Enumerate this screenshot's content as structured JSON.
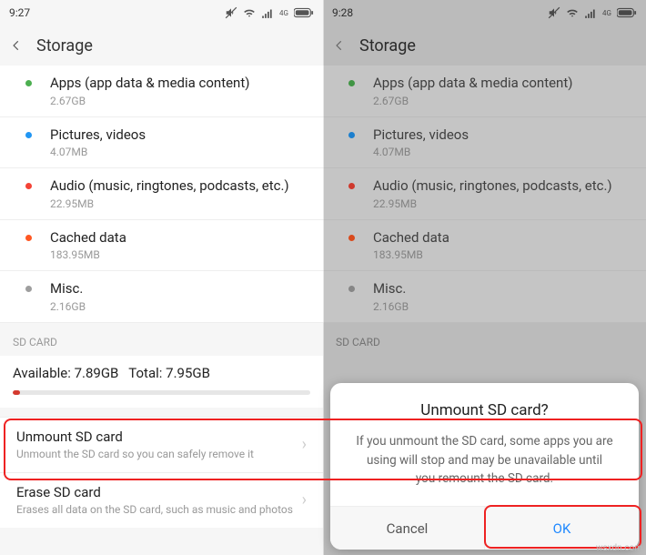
{
  "left": {
    "status_time": "9:27",
    "header_title": "Storage",
    "categories": [
      {
        "title": "Apps (app data & media content)",
        "size": "2.67GB",
        "dot": "green"
      },
      {
        "title": "Pictures, videos",
        "size": "4.07MB",
        "dot": "blue"
      },
      {
        "title": "Audio (music, ringtones, podcasts, etc.)",
        "size": "22.95MB",
        "dot": "red"
      },
      {
        "title": "Cached data",
        "size": "183.95MB",
        "dot": "orange"
      },
      {
        "title": "Misc.",
        "size": "2.16GB",
        "dot": "grey"
      }
    ],
    "sd_header": "SD CARD",
    "sd_available_label": "Available:",
    "sd_available_value": "7.89GB",
    "sd_total_label": "Total:",
    "sd_total_value": "7.95GB",
    "sd_actions": [
      {
        "title": "Unmount SD card",
        "sub": "Unmount the SD card so you can safely remove it"
      },
      {
        "title": "Erase SD card",
        "sub": "Erases all data on the SD card, such as music and photos"
      }
    ]
  },
  "right": {
    "status_time": "9:28",
    "header_title": "Storage",
    "sd_header": "SD CARD",
    "dialog_title": "Unmount SD card?",
    "dialog_body": "If you unmount the SD card, some apps you are using will stop and may be unavailable until you remount the SD card.",
    "cancel_label": "Cancel",
    "ok_label": "OK"
  },
  "watermark": "wsxdn.com"
}
